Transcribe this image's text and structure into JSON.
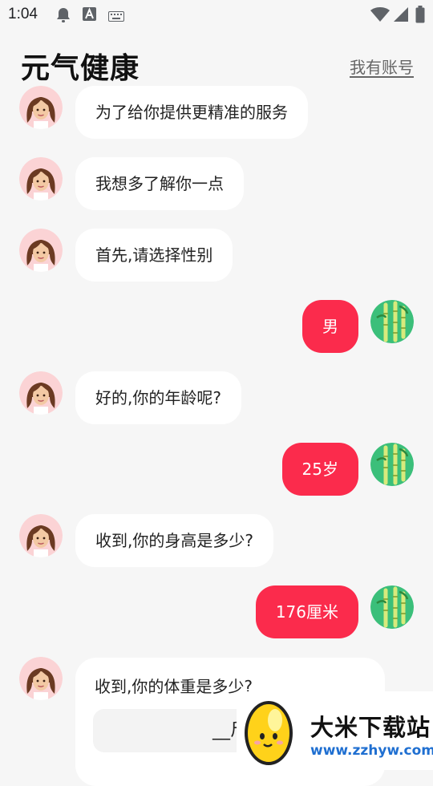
{
  "status_bar": {
    "time": "1:04"
  },
  "header": {
    "title": "元气健康",
    "account_link": "我有账号"
  },
  "messages": [
    {
      "from": "bot",
      "text": "为了给你提供更精准的服务"
    },
    {
      "from": "bot",
      "text": "我想多了解你一点"
    },
    {
      "from": "bot",
      "text": "首先,请选择性别"
    },
    {
      "from": "user",
      "text": "男"
    },
    {
      "from": "bot",
      "text": "好的,你的年龄呢?"
    },
    {
      "from": "user",
      "text": "25岁"
    },
    {
      "from": "bot",
      "text": "收到,你的身高是多少?"
    },
    {
      "from": "user",
      "text": "176厘米"
    }
  ],
  "weight_card": {
    "question": "收到,你的体重是多少?",
    "input_value": "__斤"
  },
  "watermark": {
    "name": "大米下载站",
    "url": "www.zzhyw.com"
  },
  "colors": {
    "accent": "#fb2b4c",
    "background": "#f6f6f6",
    "bubble": "#ffffff"
  }
}
